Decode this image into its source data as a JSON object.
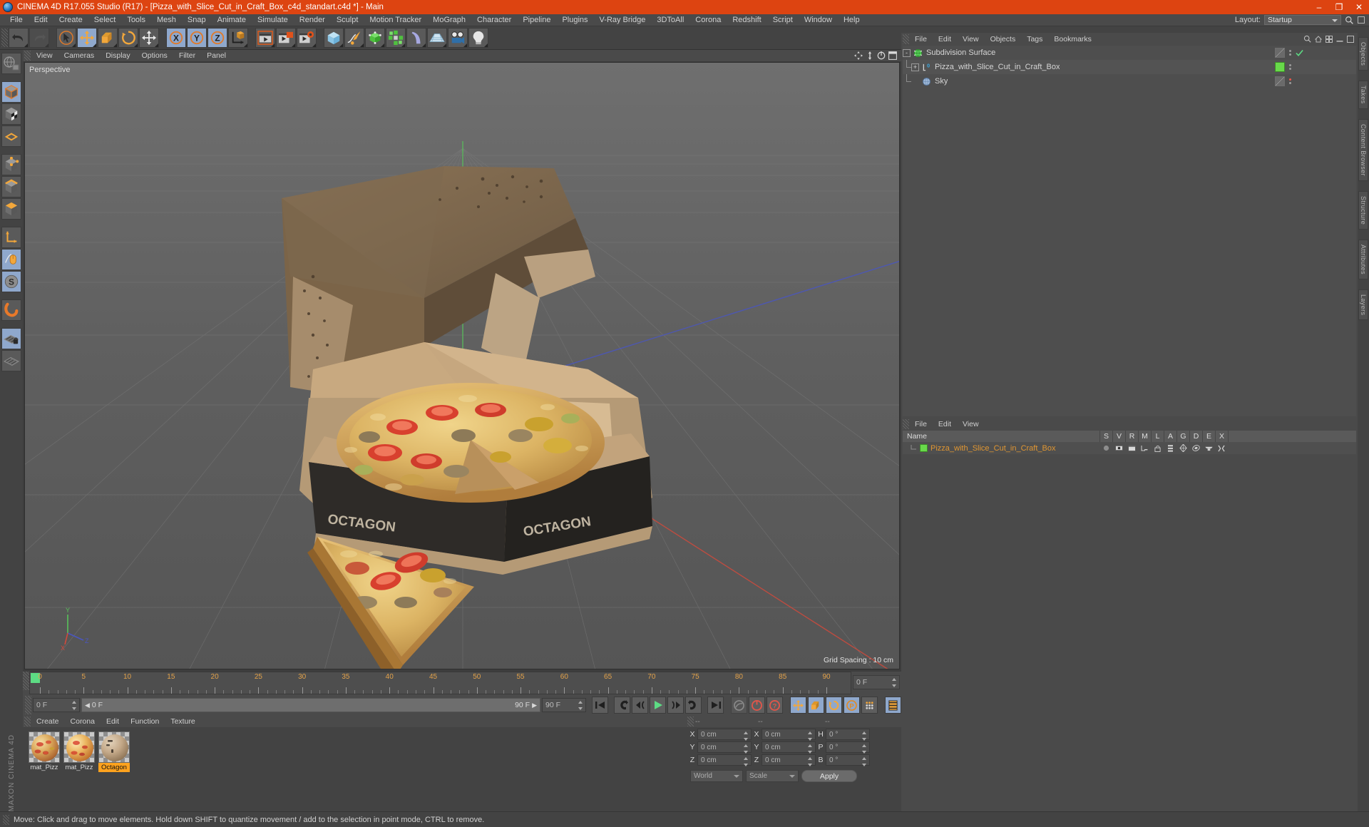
{
  "window": {
    "title": "CINEMA 4D R17.055 Studio (R17) - [Pizza_with_Slice_Cut_in_Craft_Box_c4d_standart.c4d *] - Main",
    "minimize": "–",
    "maximize": "❐",
    "close": "✕",
    "accent_color": "#dd4411"
  },
  "menubar": {
    "items": [
      "File",
      "Edit",
      "Create",
      "Select",
      "Tools",
      "Mesh",
      "Snap",
      "Animate",
      "Simulate",
      "Render",
      "Sculpt",
      "Motion Tracker",
      "MoGraph",
      "Character",
      "Pipeline",
      "Plugins",
      "V-Ray Bridge",
      "3DToAll",
      "Corona",
      "Redshift",
      "Script",
      "Window",
      "Help"
    ],
    "layout_label": "Layout:",
    "layout_value": "Startup",
    "search_icon": "search-icon"
  },
  "toolbar": {
    "groups": [
      {
        "name": "history",
        "buttons": [
          {
            "icon": "undo-icon",
            "active": false
          },
          {
            "icon": "redo-icon",
            "active": false,
            "disabled": true
          }
        ]
      },
      {
        "name": "transform-tools",
        "buttons": [
          {
            "icon": "select-live-icon",
            "active": false
          },
          {
            "icon": "move-tool-icon",
            "active": true
          },
          {
            "icon": "scale-tool-icon",
            "active": false
          },
          {
            "icon": "rotate-tool-icon",
            "active": false
          },
          {
            "icon": "move-axis-icon",
            "active": false
          }
        ]
      },
      {
        "name": "axis-locks",
        "buttons": [
          {
            "icon": "lock-x-icon",
            "active": true,
            "label": "X"
          },
          {
            "icon": "lock-y-icon",
            "active": true,
            "label": "Y"
          },
          {
            "icon": "lock-z-icon",
            "active": true,
            "label": "Z"
          },
          {
            "icon": "world-object-coords-icon",
            "active": false
          }
        ]
      },
      {
        "name": "render",
        "buttons": [
          {
            "icon": "render-view-icon",
            "active": false
          },
          {
            "icon": "render-to-picture-viewer-icon",
            "active": false
          },
          {
            "icon": "render-settings-icon",
            "active": false
          }
        ]
      },
      {
        "name": "create",
        "buttons": [
          {
            "icon": "cube-primitive-icon",
            "active": false
          },
          {
            "icon": "spline-pen-icon",
            "active": false
          },
          {
            "icon": "nurbs-generator-icon",
            "active": false
          },
          {
            "icon": "array-generator-icon",
            "active": false
          },
          {
            "icon": "bend-deformer-icon",
            "active": false
          },
          {
            "icon": "floor-environment-icon",
            "active": false
          },
          {
            "icon": "camera-icon",
            "active": false
          },
          {
            "icon": "light-icon",
            "active": false
          }
        ]
      }
    ]
  },
  "left_toolbar": {
    "buttons": [
      {
        "icon": "make-editable-icon",
        "active": false
      },
      {
        "icon": "model-mode-icon",
        "active": true
      },
      {
        "icon": "texture-mode-icon",
        "active": false
      },
      {
        "icon": "point-mode-icon",
        "active": false
      },
      {
        "icon": "edge-mode-icon",
        "active": false
      },
      {
        "icon": "polygon-mode-icon",
        "active": false
      },
      {
        "icon": "object-axis-icon",
        "active": false
      },
      {
        "icon": "viewport-solo-icon",
        "active": false
      },
      {
        "icon": "enable-axis-icon",
        "active": true
      },
      {
        "icon": "snap-mode-icon",
        "active": true
      },
      {
        "icon": "magnet-tool-icon",
        "active": false
      },
      {
        "icon": "workplane-lock-icon",
        "active": true
      },
      {
        "icon": "workplane-icon",
        "active": false
      }
    ],
    "brand": "MAXON CINEMA 4D"
  },
  "viewport": {
    "menu": [
      "View",
      "Cameras",
      "Display",
      "Options",
      "Filter",
      "Panel"
    ],
    "label": "Perspective",
    "grid_spacing": "Grid Spacing : 10 cm",
    "header_icons": [
      "pan-view-icon",
      "zoom-view-icon",
      "rotate-view-icon",
      "maximize-view-icon"
    ],
    "axis_gizmo": {
      "x": "X",
      "y": "Y",
      "z": "Z"
    }
  },
  "timeline": {
    "ticks": [
      "0",
      "5",
      "10",
      "15",
      "20",
      "25",
      "30",
      "35",
      "40",
      "45",
      "50",
      "55",
      "60",
      "65",
      "70",
      "75",
      "80",
      "85",
      "90"
    ],
    "min": 0,
    "max": 90,
    "current_frame": "0 F",
    "range_start": "0 F",
    "range_end": "90 F",
    "preview_end": "90 F",
    "playhead_frame": "0 F"
  },
  "playback": {
    "buttons": [
      {
        "icon": "go-to-start-icon"
      },
      {
        "icon": "previous-keyframe-icon"
      },
      {
        "icon": "previous-frame-icon"
      },
      {
        "icon": "play-icon"
      },
      {
        "icon": "next-frame-icon"
      },
      {
        "icon": "next-keyframe-icon"
      },
      {
        "icon": "go-to-end-icon"
      },
      {
        "icon": "record-active-objects-icon"
      },
      {
        "icon": "autokeying-icon"
      },
      {
        "icon": "keyframe-selection-icon"
      },
      {
        "icon": "position-key-icon"
      },
      {
        "icon": "scale-key-icon"
      },
      {
        "icon": "rotation-key-icon"
      },
      {
        "icon": "parameter-key-icon"
      },
      {
        "icon": "point-level-animation-icon"
      },
      {
        "icon": "timeline-window-icon"
      }
    ]
  },
  "material_manager": {
    "menu": [
      "Create",
      "Corona",
      "Edit",
      "Function",
      "Texture"
    ],
    "materials": [
      {
        "name": "mat_Pizz",
        "selected": false,
        "swatch": "#c98a52",
        "type": "pizza-material"
      },
      {
        "name": "mat_Pizz",
        "selected": false,
        "swatch": "#d9944f",
        "type": "pizza-material"
      },
      {
        "name": "Octagon",
        "selected": true,
        "swatch": "#b7a088",
        "type": "box-material"
      }
    ]
  },
  "coordinates": {
    "header": [
      "--",
      "--",
      "--"
    ],
    "rows": [
      {
        "pos_label": "X",
        "pos_value": "0 cm",
        "size_label": "X",
        "size_value": "0 cm",
        "rot_label": "H",
        "rot_value": "0 °"
      },
      {
        "pos_label": "Y",
        "pos_value": "0 cm",
        "size_label": "Y",
        "size_value": "0 cm",
        "rot_label": "P",
        "rot_value": "0 °"
      },
      {
        "pos_label": "Z",
        "pos_value": "0 cm",
        "size_label": "Z",
        "size_value": "0 cm",
        "rot_label": "B",
        "rot_value": "0 °"
      }
    ],
    "system": "World",
    "mode": "Scale",
    "apply": "Apply"
  },
  "object_manager": {
    "menu": [
      "File",
      "Edit",
      "View",
      "Objects",
      "Tags",
      "Bookmarks"
    ],
    "rows": [
      {
        "label": "Subdivision Surface",
        "depth": 0,
        "expander": "-",
        "icon": "subdivision-surface-icon",
        "tag": "half",
        "visible_check": true,
        "selected": false
      },
      {
        "label": "Pizza_with_Slice_Cut_in_Craft_Box",
        "depth": 1,
        "expander": "+",
        "icon": "polygon-object-icon",
        "tag": "green",
        "visible_check": false,
        "selected": true
      },
      {
        "label": "Sky",
        "depth": 1,
        "expander": "",
        "icon": "sky-object-icon",
        "tag": "half",
        "visible_check": false,
        "selected": false,
        "dot_red": true
      }
    ]
  },
  "layer_manager": {
    "menu": [
      "File",
      "Edit",
      "View"
    ],
    "columns": [
      "Name",
      "S",
      "V",
      "R",
      "M",
      "L",
      "A",
      "G",
      "D",
      "E",
      "X"
    ],
    "rows": [
      {
        "name": "Pizza_with_Slice_Cut_in_Craft_Box",
        "color": "#68d94a"
      }
    ]
  },
  "right_rail": {
    "tabs": [
      "Objects",
      "Takes",
      "Content Browser",
      "Structure",
      "Attributes",
      "Layers"
    ]
  },
  "statusbar": {
    "message": "Move: Click and drag to move elements. Hold down SHIFT to quantize movement / add to the selection in point mode, CTRL to remove."
  }
}
